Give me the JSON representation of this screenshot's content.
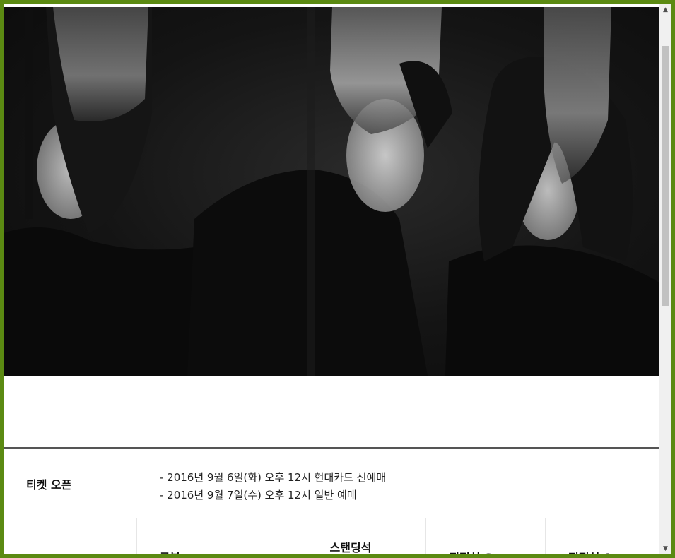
{
  "event": {
    "ticket_open_label": "티켓 오픈",
    "ticket_open_lines": [
      "- 2016년 9월 6일(화) 오후 12시 현대카드 선예매",
      "- 2016년 9월 7일(수) 오후 12시 일반 예매"
    ],
    "price_table": {
      "headers": [
        "구분",
        "스탠딩석",
        "지정석 S",
        "지정석 A"
      ]
    }
  },
  "scrollbar": {
    "up_icon": "▲",
    "down_icon": "▼"
  }
}
